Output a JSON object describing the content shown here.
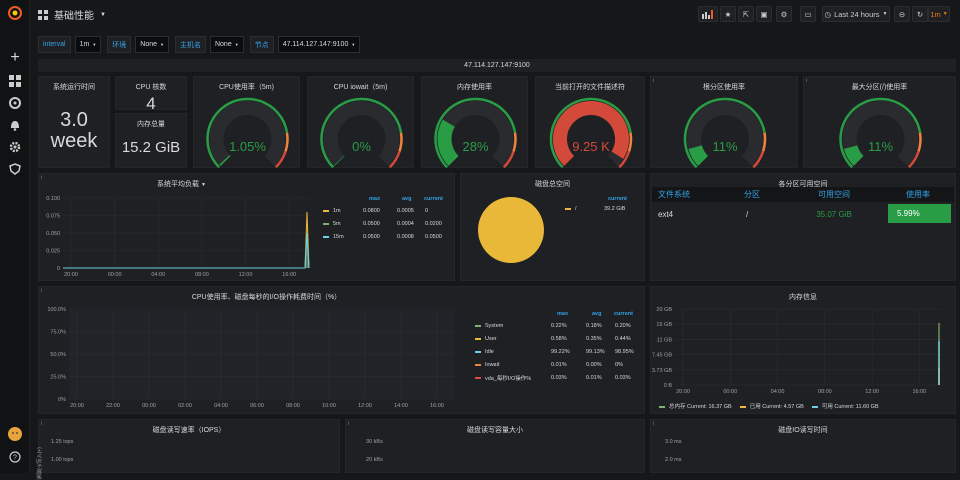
{
  "dashboard": {
    "title": "基础性能",
    "time_range": "Last 24 hours",
    "refresh": "1m"
  },
  "colors": {
    "blue": "#33a2e5",
    "green": "#299c46",
    "yellow": "#eab839",
    "red": "#d44a3a",
    "orange": "#ef843c",
    "bright_green": "#7eb26d"
  },
  "variables": [
    {
      "label": "interval",
      "value": "1m"
    },
    {
      "label": "环境",
      "value": "None"
    },
    {
      "label": "主机名",
      "value": "None"
    },
    {
      "label": "节点",
      "value": "47.114.127.147:9100"
    }
  ],
  "row_title": "47.114.127.147:9100",
  "stats": {
    "uptime": {
      "title": "系统运行时间",
      "value": "3.0",
      "unit": "week"
    },
    "cpu_cores": {
      "title": "CPU 核数",
      "value": "4"
    },
    "mem_total": {
      "title": "内存总量",
      "value": "15.2 GiB"
    }
  },
  "gauges": [
    {
      "title": "CPU使用率（5m)",
      "value": "1.05%",
      "fraction": 0.0105,
      "color": "#299c46"
    },
    {
      "title": "CPU iowait（5m)",
      "value": "0%",
      "fraction": 0.0,
      "color": "#299c46"
    },
    {
      "title": "内存使用率",
      "value": "28%",
      "fraction": 0.28,
      "color": "#299c46"
    },
    {
      "title": "当前打开的文件描述符",
      "value": "9.25 K",
      "fraction": 0.95,
      "color": "#d44a3a"
    },
    {
      "title": "根分区使用率",
      "value": "11%",
      "fraction": 0.11,
      "color": "#299c46"
    },
    {
      "title": "最大分区(/)使用率",
      "value": "11%",
      "fraction": 0.11,
      "color": "#299c46"
    }
  ],
  "load_panel": {
    "title": "系统平均负载",
    "legend_headers": [
      "max",
      "avg",
      "current"
    ],
    "legend": [
      {
        "name": "1m",
        "color": "#eab839",
        "max": "0.0800",
        "avg": "0.0005",
        "current": "0"
      },
      {
        "name": "5m",
        "color": "#7eb26d",
        "max": "0.0500",
        "avg": "0.0004",
        "current": "0.0200"
      },
      {
        "name": "15m",
        "color": "#6ed0e0",
        "max": "0.0500",
        "avg": "0.0008",
        "current": "0.0500"
      }
    ]
  },
  "disk_total": {
    "title": "磁盘总空间",
    "legend_header": "current",
    "legend": [
      {
        "name": "/",
        "value": "39.2 GiB",
        "color": "#eab839"
      }
    ]
  },
  "partition_table": {
    "title": "各分区可用空间",
    "headers": [
      "文件系统",
      "分区",
      "可用空间",
      "使用率"
    ],
    "rows": [
      {
        "fs": "ext4",
        "mount": "/",
        "avail": "35.07 GiB",
        "usage": "5.99%"
      }
    ]
  },
  "cpu_io_panel": {
    "title": "CPU使用率、磁盘每秒的I/O操作耗费时间（%）",
    "legend_headers": [
      "max",
      "avg",
      "current"
    ],
    "legend": [
      {
        "name": "System",
        "color": "#7eb26d",
        "max": "0.22%",
        "avg": "0.18%",
        "current": "0.20%"
      },
      {
        "name": "User",
        "color": "#eab839",
        "max": "0.58%",
        "avg": "0.35%",
        "current": "0.44%"
      },
      {
        "name": "Idle",
        "color": "#6ed0e0",
        "max": "99.22%",
        "avg": "99.13%",
        "current": "98.95%"
      },
      {
        "name": "Iowait",
        "color": "#ef843c",
        "max": "0.01%",
        "avg": "0.00%",
        "current": "0%"
      },
      {
        "name": "vda_每秒I/O操作%",
        "color": "#e24d42",
        "max": "0.03%",
        "avg": "0.01%",
        "current": "0.03%"
      }
    ]
  },
  "memory_panel": {
    "title": "内存信息",
    "legend": [
      {
        "name": "总内存",
        "label": "Current:",
        "value": "16.37 GB",
        "color": "#7eb26d"
      },
      {
        "name": "已用",
        "label": "Current:",
        "value": "4.57 GB",
        "color": "#eab839"
      },
      {
        "name": "可用",
        "label": "Current:",
        "value": "11.60 GB",
        "color": "#6ed0e0"
      }
    ]
  },
  "bottom_panels": [
    {
      "title": "磁盘读写速率（IOPS）",
      "y_ticks": [
        "1.25 iops",
        "1.00 iops"
      ],
      "y_label": "读取(-)/写入(+)"
    },
    {
      "title": "磁盘读写容量大小",
      "y_ticks": [
        "30 kBs",
        "20 kBs"
      ]
    },
    {
      "title": "磁盘IO读写时间",
      "y_ticks": [
        "3.0 ms",
        "2.0 ms"
      ]
    }
  ],
  "chart_data": [
    {
      "type": "line",
      "title": "系统平均负载",
      "x": [
        "20:00",
        "00:00",
        "04:00",
        "08:00",
        "12:00",
        "16:00"
      ],
      "ylim": [
        0,
        0.1
      ],
      "yticks": [
        "0",
        "0.025",
        "0.050",
        "0.075",
        "0.100"
      ],
      "series": [
        {
          "name": "1m",
          "values": [
            0,
            0,
            0,
            0,
            0,
            0,
            0.08
          ]
        },
        {
          "name": "5m",
          "values": [
            0,
            0,
            0,
            0,
            0,
            0,
            0.05
          ]
        },
        {
          "name": "15m",
          "values": [
            0,
            0,
            0,
            0,
            0,
            0,
            0.05
          ]
        }
      ]
    },
    {
      "type": "pie",
      "title": "磁盘总空间",
      "series": [
        {
          "name": "/",
          "values": [
            39.2
          ]
        }
      ]
    },
    {
      "type": "line",
      "title": "CPU使用率、磁盘每秒的I/O操作耗费时间（%）",
      "x": [
        "20:00",
        "22:00",
        "00:00",
        "02:00",
        "04:00",
        "06:00",
        "08:00",
        "10:00",
        "12:00",
        "14:00",
        "16:00"
      ],
      "ylim": [
        0,
        100
      ],
      "yticks": [
        "0%",
        "25.0%",
        "50.0%",
        "75.0%",
        "100.0%"
      ],
      "series": [
        {
          "name": "Idle",
          "values": [
            99.13,
            99.13,
            99.13,
            99.13,
            99.13,
            99.13,
            99.13,
            99.13,
            99.13,
            99.13,
            99.13
          ]
        },
        {
          "name": "User",
          "values": [
            0.35,
            0.35,
            0.35,
            0.35,
            0.35,
            0.35,
            0.35,
            0.35,
            0.35,
            0.35,
            0.35
          ]
        },
        {
          "name": "System",
          "values": [
            0.18,
            0.18,
            0.18,
            0.18,
            0.18,
            0.18,
            0.18,
            0.18,
            0.18,
            0.18,
            0.18
          ]
        }
      ]
    },
    {
      "type": "line",
      "title": "内存信息",
      "x": [
        "20:00",
        "00:00",
        "04:00",
        "08:00",
        "12:00",
        "16:00"
      ],
      "ylim": [
        0,
        20
      ],
      "yticks": [
        "0 B",
        "3.73 GB",
        "7.45 GB",
        "11 GB",
        "15 GB",
        "20 GB"
      ],
      "series": [
        {
          "name": "总内存",
          "values": [
            16.37
          ]
        },
        {
          "name": "已用",
          "values": [
            4.57
          ]
        },
        {
          "name": "可用",
          "values": [
            11.6
          ]
        }
      ]
    }
  ]
}
